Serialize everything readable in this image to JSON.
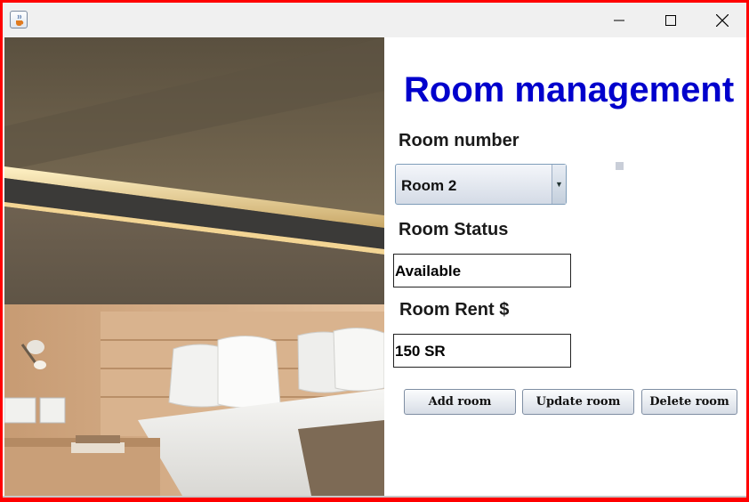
{
  "window": {
    "title_icon": "java-cup-icon",
    "controls": {
      "minimize": "minimize-icon",
      "maximize": "maximize-icon",
      "close": "close-icon"
    }
  },
  "photo": {
    "subject": "hotel-bedroom-photo"
  },
  "form": {
    "heading": "Room management",
    "room_number_label": "Room number",
    "room_number_value": "Room 2",
    "room_status_label": "Room Status",
    "room_status_value": "Available",
    "room_rent_label": "Room Rent $",
    "room_rent_value": "150 SR"
  },
  "buttons": {
    "add": "Add room",
    "update": "Update room",
    "delete": "Delete room"
  },
  "colors": {
    "heading": "#0000cc",
    "frame": "#ff0000"
  }
}
